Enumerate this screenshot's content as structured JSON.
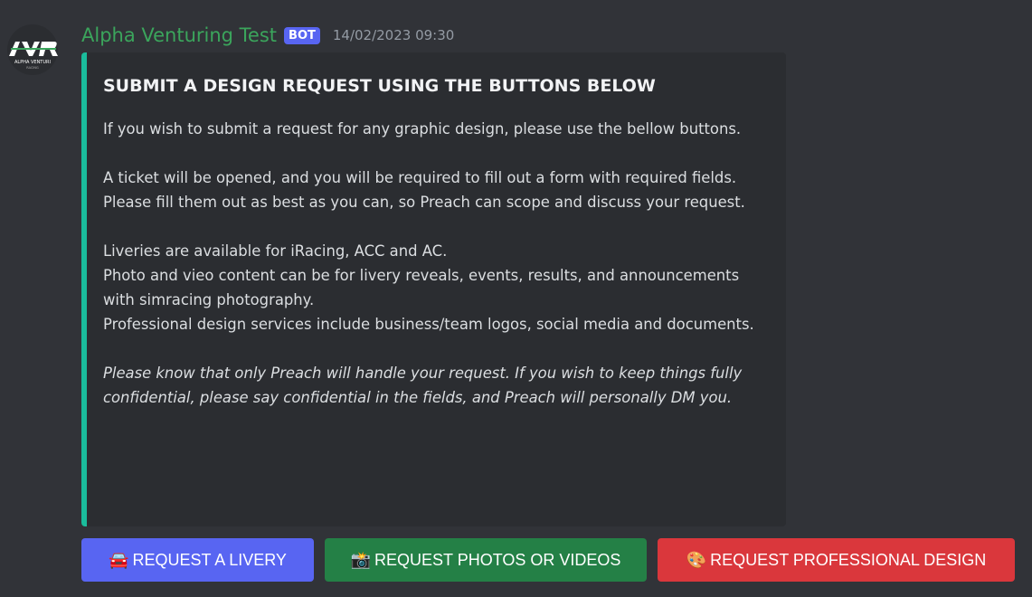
{
  "message": {
    "username": "Alpha Venturing Test",
    "bot_tag": "BOT",
    "timestamp": "14/02/2023 09:30",
    "avatar": {
      "logo_text": "AVR",
      "sub_text": "ALPHA VENTURI",
      "sub_text2": "RACING"
    }
  },
  "embed": {
    "accent_color": "#1abc9c",
    "title": "SUBMIT A DESIGN REQUEST USING THE BUTTONS BELOW",
    "lines": [
      "If you wish to submit a request for any graphic design, please use the bellow buttons.",
      "",
      "A ticket will be opened, and you will be required to fill out a form with required fields. Please fill them out as best as you can, so Preach can scope and discuss your request.",
      "",
      "Liveries are available for iRacing, ACC and AC.",
      "Photo and vieo content can be for livery reveals, events, results, and announcements with simracing photography.",
      "Professional design services include business/team logos, social media and documents.",
      ""
    ],
    "italic_note": "Please know that only Preach will handle your request. If you wish to keep things fully confidential, please say confidential in the fields, and Preach will personally DM you."
  },
  "buttons": [
    {
      "emoji": "🚘",
      "label": "REQUEST A LIVERY",
      "color": "#5865f2"
    },
    {
      "emoji": "📸",
      "label": "REQUEST PHOTOS OR VIDEOS",
      "color": "#248046"
    },
    {
      "emoji": "🎨",
      "label": "REQUEST PROFESSIONAL DESIGN",
      "color": "#da373c"
    }
  ]
}
